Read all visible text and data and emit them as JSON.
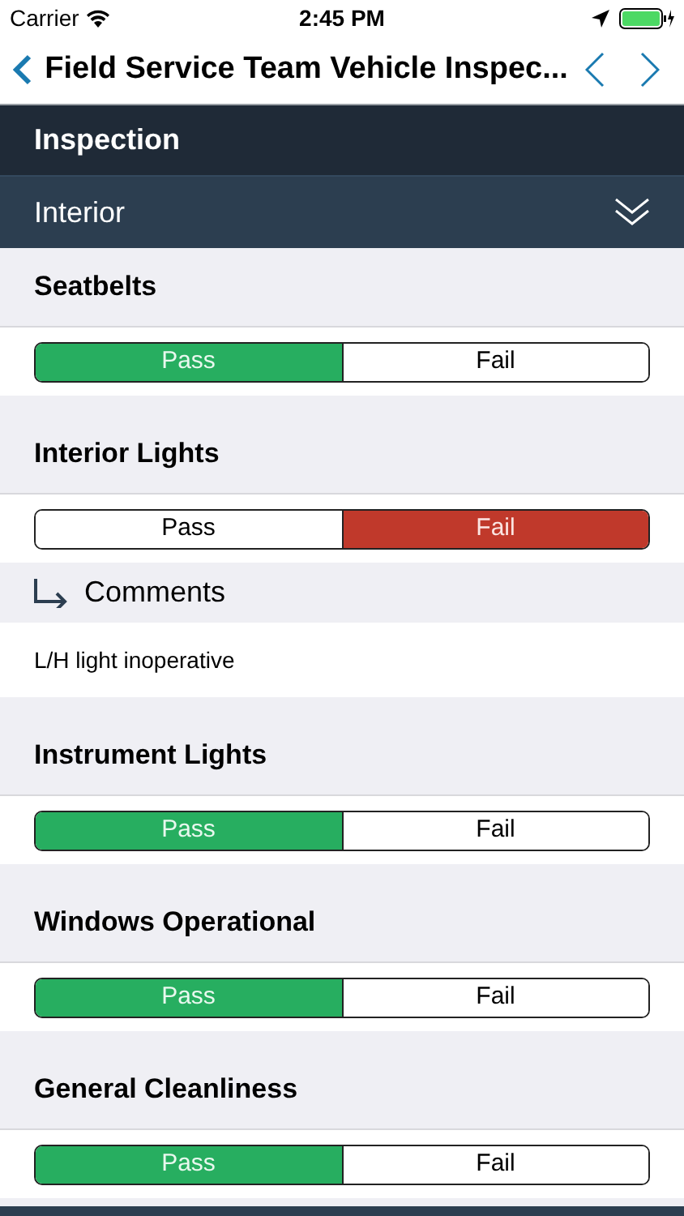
{
  "status_bar": {
    "carrier": "Carrier",
    "time": "2:45 PM"
  },
  "nav": {
    "title": "Field Service Team Vehicle Inspec..."
  },
  "section": {
    "title": "Inspection"
  },
  "group": {
    "title": "Interior"
  },
  "items": [
    {
      "label": "Seatbelts",
      "options": [
        {
          "label": "Pass",
          "kind": "pass",
          "selected": true
        },
        {
          "label": "Fail",
          "kind": "fail",
          "selected": false
        }
      ]
    },
    {
      "label": "Interior Lights",
      "options": [
        {
          "label": "Pass",
          "kind": "pass",
          "selected": false
        },
        {
          "label": "Fail",
          "kind": "fail",
          "selected": true
        }
      ],
      "comments": {
        "label": "Comments",
        "text": "L/H light inoperative"
      }
    },
    {
      "label": "Instrument Lights",
      "options": [
        {
          "label": "Pass",
          "kind": "pass",
          "selected": true
        },
        {
          "label": "Fail",
          "kind": "fail",
          "selected": false
        }
      ]
    },
    {
      "label": "Windows Operational",
      "options": [
        {
          "label": "Pass",
          "kind": "pass",
          "selected": true
        },
        {
          "label": "Fail",
          "kind": "fail",
          "selected": false
        }
      ]
    },
    {
      "label": "General Cleanliness",
      "options": [
        {
          "label": "Pass",
          "kind": "pass",
          "selected": true
        },
        {
          "label": "Fail",
          "kind": "fail",
          "selected": false
        }
      ]
    }
  ]
}
